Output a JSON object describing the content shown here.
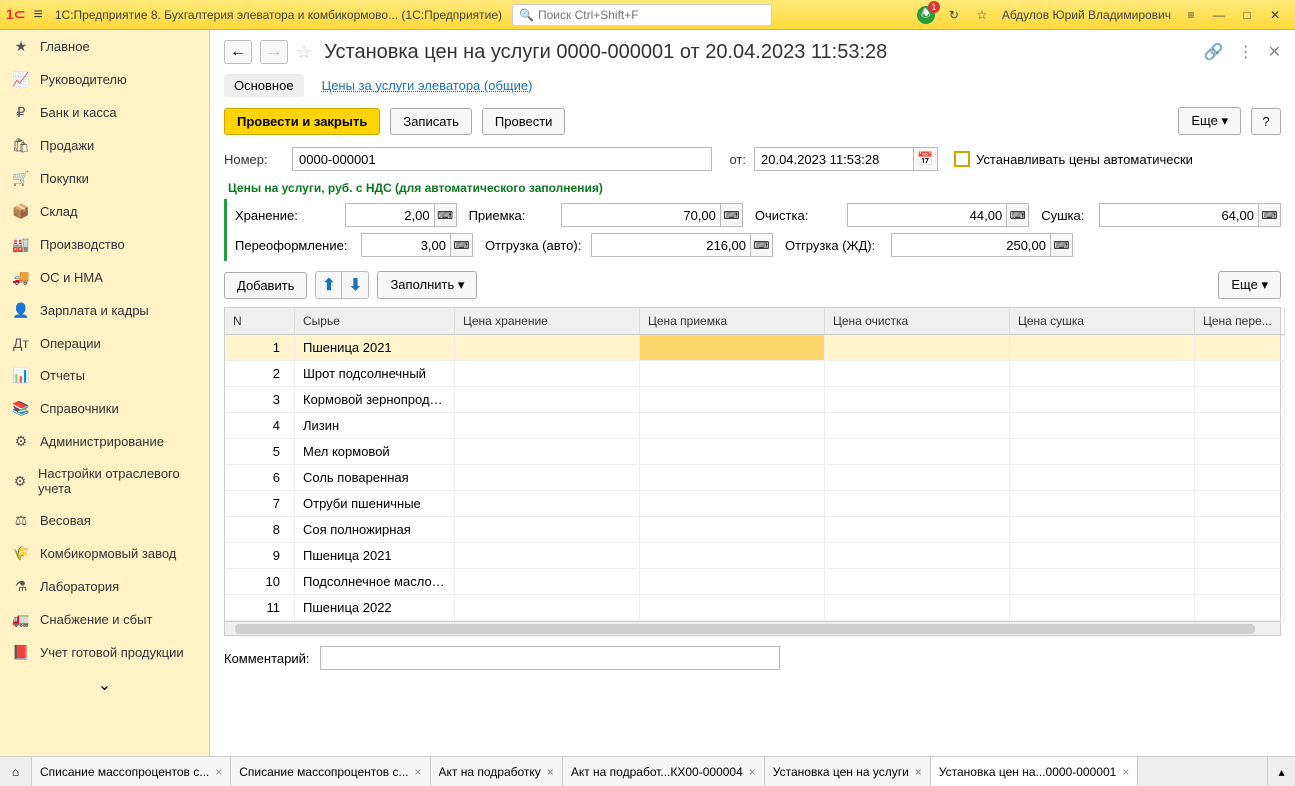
{
  "titlebar": {
    "app_title": "1С:Предприятие 8. Бухгалтерия элеватора и комбикормово...   (1С:Предприятие)",
    "search_placeholder": "Поиск Ctrl+Shift+F",
    "user_name": "Абдулов Юрий Владимирович",
    "bell_badge": "1"
  },
  "sidebar": {
    "items": [
      {
        "icon": "★",
        "label": "Главное"
      },
      {
        "icon": "📈",
        "label": "Руководителю"
      },
      {
        "icon": "₽",
        "label": "Банк и касса"
      },
      {
        "icon": "🛍",
        "label": "Продажи"
      },
      {
        "icon": "🛒",
        "label": "Покупки"
      },
      {
        "icon": "📦",
        "label": "Склад"
      },
      {
        "icon": "🏭",
        "label": "Производство"
      },
      {
        "icon": "🚚",
        "label": "ОС и НМА"
      },
      {
        "icon": "👤",
        "label": "Зарплата и кадры"
      },
      {
        "icon": "Дт",
        "label": "Операции"
      },
      {
        "icon": "📊",
        "label": "Отчеты"
      },
      {
        "icon": "📚",
        "label": "Справочники"
      },
      {
        "icon": "⚙",
        "label": "Администрирование"
      },
      {
        "icon": "⚙",
        "label": "Настройки отраслевого учета"
      },
      {
        "icon": "⚖",
        "label": "Весовая"
      },
      {
        "icon": "🌾",
        "label": "Комбикормовый завод"
      },
      {
        "icon": "⚗",
        "label": "Лаборатория"
      },
      {
        "icon": "🚛",
        "label": "Снабжение и сбыт"
      },
      {
        "icon": "📕",
        "label": "Учет готовой продукции"
      }
    ]
  },
  "doc": {
    "title": "Установка цен на услуги 0000-000001 от 20.04.2023 11:53:28",
    "tab_main": "Основное",
    "tab_link": "Цены за услуги элеватора (общие)",
    "btn_post_close": "Провести и закрыть",
    "btn_save": "Записать",
    "btn_post": "Провести",
    "btn_more": "Еще",
    "btn_help": "?",
    "lbl_number": "Номер:",
    "val_number": "0000-000001",
    "lbl_date": "от:",
    "val_date": "20.04.2023 11:53:28",
    "chk_auto": "Устанавливать цены автоматически",
    "green_title": "Цены на услуги, руб. с НДС (для автоматического заполнения)",
    "prices": {
      "storage_lbl": "Хранение:",
      "storage_val": "2,00",
      "intake_lbl": "Приемка:",
      "intake_val": "70,00",
      "clean_lbl": "Очистка:",
      "clean_val": "44,00",
      "dry_lbl": "Сушка:",
      "dry_val": "64,00",
      "reform_lbl": "Переоформление:",
      "reform_val": "3,00",
      "ship_auto_lbl": "Отгрузка (авто):",
      "ship_auto_val": "216,00",
      "ship_rail_lbl": "Отгрузка (ЖД):",
      "ship_rail_val": "250,00"
    },
    "tbl_toolbar": {
      "add": "Добавить",
      "fill": "Заполнить",
      "more": "Еще"
    },
    "columns": [
      "N",
      "Сырье",
      "Цена хранение",
      "Цена приемка",
      "Цена очистка",
      "Цена сушка",
      "Цена пере..."
    ],
    "rows": [
      {
        "n": "1",
        "name": "Пшеница 2021"
      },
      {
        "n": "2",
        "name": "Шрот подсолнечный"
      },
      {
        "n": "3",
        "name": "Кормовой зернопрод…"
      },
      {
        "n": "4",
        "name": "Лизин"
      },
      {
        "n": "5",
        "name": "Мел кормовой"
      },
      {
        "n": "6",
        "name": "Соль поваренная"
      },
      {
        "n": "7",
        "name": "Отруби пшеничные"
      },
      {
        "n": "8",
        "name": "Соя полножирная"
      },
      {
        "n": "9",
        "name": "Пшеница 2021"
      },
      {
        "n": "10",
        "name": "Подсолнечное масло…"
      },
      {
        "n": "11",
        "name": "Пшеница 2022"
      }
    ],
    "comment_lbl": "Комментарий:"
  },
  "bottom_tabs": [
    {
      "label": "Списание массопроцентов с...",
      "active": false
    },
    {
      "label": "Списание массопроцентов с...",
      "active": false
    },
    {
      "label": "Акт на подработку",
      "active": false
    },
    {
      "label": "Акт на подработ...КХ00-000004",
      "active": false
    },
    {
      "label": "Установка цен на услуги",
      "active": false
    },
    {
      "label": "Установка цен на...0000-000001",
      "active": true
    }
  ]
}
